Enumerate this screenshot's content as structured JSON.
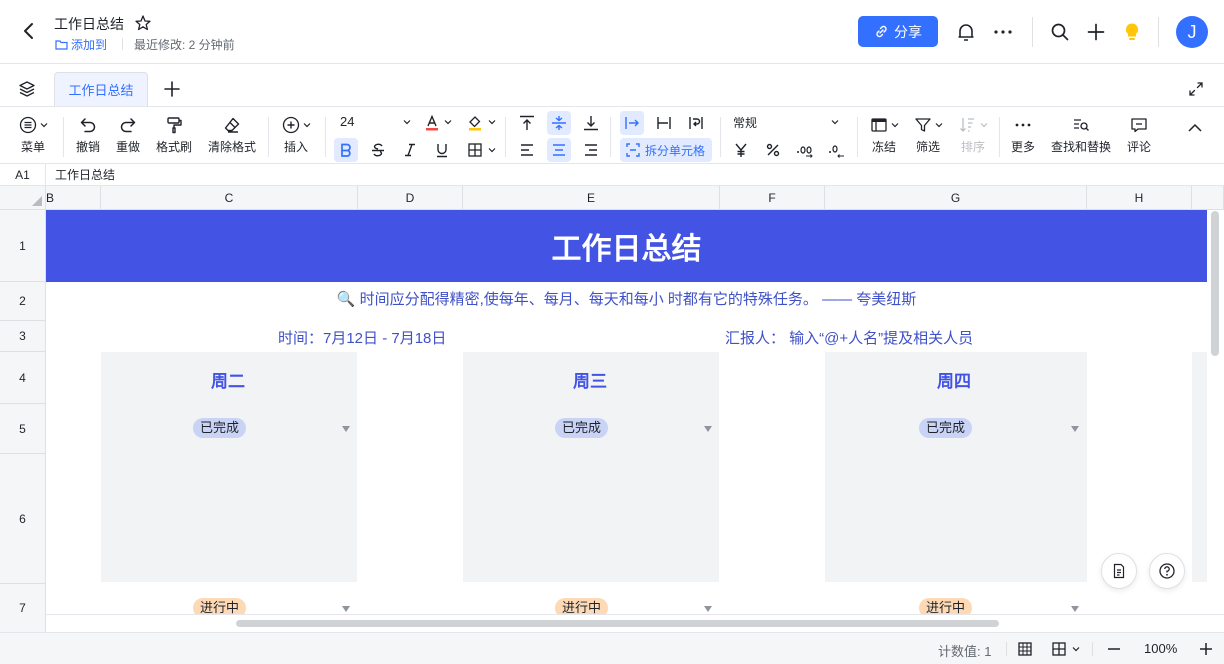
{
  "header": {
    "doc_title": "工作日总结",
    "add_to": "添加到",
    "last_modified": "最近修改: 2 分钟前",
    "share": "分享",
    "avatar_letter": "J"
  },
  "tabs": {
    "active": "工作日总结"
  },
  "toolbar": {
    "menu": "菜单",
    "undo": "撤销",
    "redo": "重做",
    "format_painter": "格式刷",
    "clear_format": "清除格式",
    "insert": "插入",
    "font_size": "24",
    "split_cells": "拆分单元格",
    "number_format": "常规",
    "freeze": "冻结",
    "filter": "筛选",
    "sort": "排序",
    "more": "更多",
    "find_replace": "查找和替换",
    "comment": "评论"
  },
  "formula_bar": {
    "cell_ref": "A1",
    "content": "工作日总结"
  },
  "columns": [
    "B",
    "C",
    "D",
    "E",
    "F",
    "G",
    "H"
  ],
  "rows": [
    "1",
    "2",
    "3",
    "4",
    "5",
    "6",
    "7"
  ],
  "sheet": {
    "banner": "工作日总结",
    "quote": "🔍 时间应分配得精密,使每年、每月、每天和每小 时都有它的特殊任务。 —— 夸美纽斯",
    "time": "时间：7月12日 - 7月18日",
    "reporter": "汇报人：  输入“@+人名”提及相关人员",
    "days": [
      {
        "name": "周二",
        "status_done": "已完成",
        "status_progress": "进行中"
      },
      {
        "name": "周三",
        "status_done": "已完成",
        "status_progress": "进行中"
      },
      {
        "name": "周四",
        "status_done": "已完成",
        "status_progress": "进行中"
      }
    ]
  },
  "status_bar": {
    "count": "计数值: 1",
    "zoom": "100%"
  },
  "colors": {
    "accent": "#3370ff",
    "banner": "#4354e5",
    "done_pill": "#c9d3f5",
    "progress_pill": "#fdd9b5"
  }
}
